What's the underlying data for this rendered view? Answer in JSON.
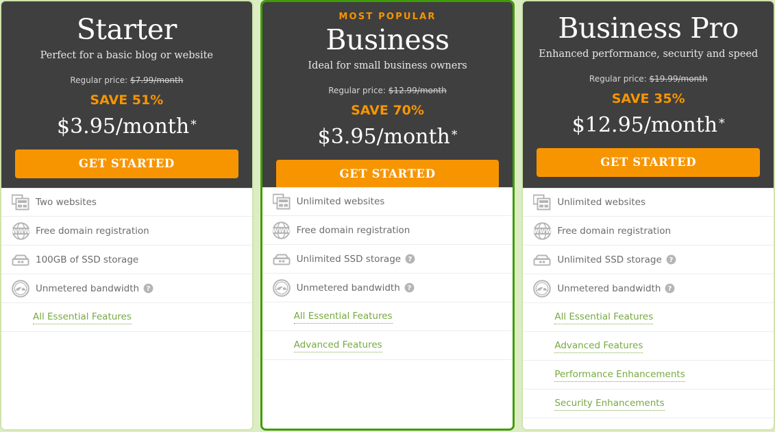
{
  "theme": {
    "page_background": "#dcedc4",
    "card_background": "#ffffff",
    "header_background": "#3f3f3f",
    "accent_orange": "#f79500",
    "accent_green": "#3f9c07",
    "link_green": "#76a940",
    "border_green_light": "#cfe3ac",
    "feature_text": "#6b6b6b"
  },
  "plans": [
    {
      "id": "starter",
      "badge": "",
      "featured": false,
      "name": "Starter",
      "tagline": "Perfect for a basic blog or website",
      "regular_price_label": "Regular price:",
      "regular_price_value": "$7.99/month",
      "save_label": "SAVE 51%",
      "price": "$3.95/month",
      "price_asterisk": "*",
      "cta_label": "GET STARTED",
      "features": [
        {
          "icon": "websites-icon",
          "label": "Two websites",
          "help": false
        },
        {
          "icon": "domain-www-icon",
          "label": "Free domain registration",
          "help": false
        },
        {
          "icon": "ssd-storage-icon",
          "label": "100GB of SSD storage",
          "help": false
        },
        {
          "icon": "bandwidth-gauge-icon",
          "label": "Unmetered bandwidth",
          "help": true
        }
      ],
      "links": [
        "All Essential Features"
      ]
    },
    {
      "id": "business",
      "badge": "MOST POPULAR",
      "featured": true,
      "name": "Business",
      "tagline": "Ideal for small business owners",
      "regular_price_label": "Regular price:",
      "regular_price_value": "$12.99/month",
      "save_label": "SAVE 70%",
      "price": "$3.95/month",
      "price_asterisk": "*",
      "cta_label": "GET STARTED",
      "features": [
        {
          "icon": "websites-icon",
          "label": "Unlimited websites",
          "help": false
        },
        {
          "icon": "domain-www-icon",
          "label": "Free domain registration",
          "help": false
        },
        {
          "icon": "ssd-storage-icon",
          "label": "Unlimited SSD storage",
          "help": true
        },
        {
          "icon": "bandwidth-gauge-icon",
          "label": "Unmetered bandwidth",
          "help": true
        }
      ],
      "links": [
        "All Essential Features",
        "Advanced Features"
      ]
    },
    {
      "id": "business-pro",
      "badge": "",
      "featured": false,
      "name": "Business Pro",
      "tagline": "Enhanced performance, security and speed",
      "regular_price_label": "Regular price:",
      "regular_price_value": "$19.99/month",
      "save_label": "SAVE 35%",
      "price": "$12.95/month",
      "price_asterisk": "*",
      "cta_label": "GET STARTED",
      "features": [
        {
          "icon": "websites-icon",
          "label": "Unlimited websites",
          "help": false
        },
        {
          "icon": "domain-www-icon",
          "label": "Free domain registration",
          "help": false
        },
        {
          "icon": "ssd-storage-icon",
          "label": "Unlimited SSD storage",
          "help": true
        },
        {
          "icon": "bandwidth-gauge-icon",
          "label": "Unmetered bandwidth",
          "help": true
        }
      ],
      "links": [
        "All Essential Features",
        "Advanced Features",
        "Performance Enhancements",
        "Security Enhancements"
      ]
    }
  ]
}
